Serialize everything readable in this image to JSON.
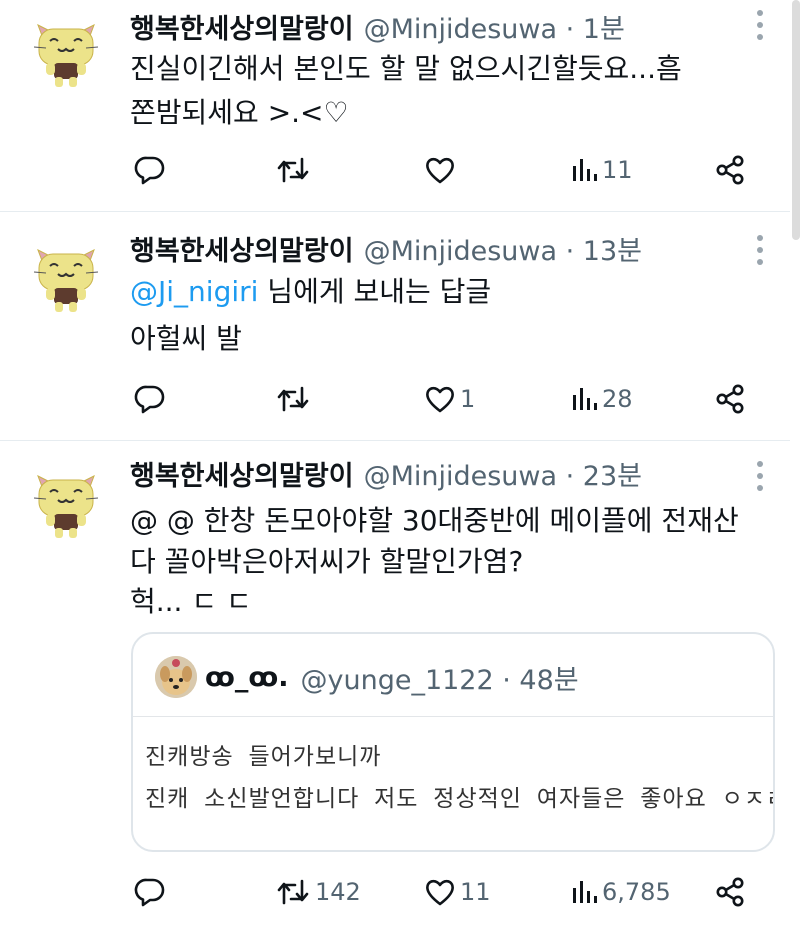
{
  "tweets": [
    {
      "display_name": "행복한세상의말랑이",
      "handle": "@Minjidesuwa",
      "time": "1분",
      "lines": [
        "진실이긴해서 본인도 할 말 없으시긴할듯요...흠",
        "쫀밤되세요 >.<♡"
      ],
      "reply_count": "",
      "retweet_count": "",
      "like_count": "",
      "view_count": "11"
    },
    {
      "display_name": "행복한세상의말랑이",
      "handle": "@Minjidesuwa",
      "time": "13분",
      "reply_to_mention": "@Ji_nigiri",
      "reply_to_suffix": " 님에게 보내는 답글",
      "lines": [
        "아헐씨 발"
      ],
      "reply_count": "",
      "retweet_count": "",
      "like_count": "1",
      "view_count": "28"
    },
    {
      "display_name": "행복한세상의말랑이",
      "handle": "@Minjidesuwa",
      "time": "23분",
      "lines": [
        "@ @ 한창 돈모아야할 30대중반에 메이플에 전재산",
        "다 꼴아박은아저씨가 할말인가염?",
        "헉... ㄷ ㄷ"
      ],
      "quote": {
        "display_name": "ꝏ_ꝏ.",
        "handle": "@yunge_1122",
        "time": "48분",
        "lines": [
          "진캐방송 들어가보니까",
          "진캐 소신발언합니다 저도 정상적인 여자들은 좋아요 ㅇㅈㄹ."
        ]
      },
      "reply_count": "",
      "retweet_count": "142",
      "like_count": "11",
      "view_count": "6,785"
    }
  ],
  "separator": " · ",
  "icons": {
    "reply": "reply-icon",
    "retweet": "retweet-icon",
    "like": "heart-icon",
    "views": "views-icon",
    "share": "share-icon",
    "more": "more-dots-icon"
  },
  "colors": {
    "text": "#0f1419",
    "secondary": "#536471",
    "mention": "#1d9bf0",
    "divider": "#e6ecf0",
    "avatar_cat": "#ece38a"
  }
}
